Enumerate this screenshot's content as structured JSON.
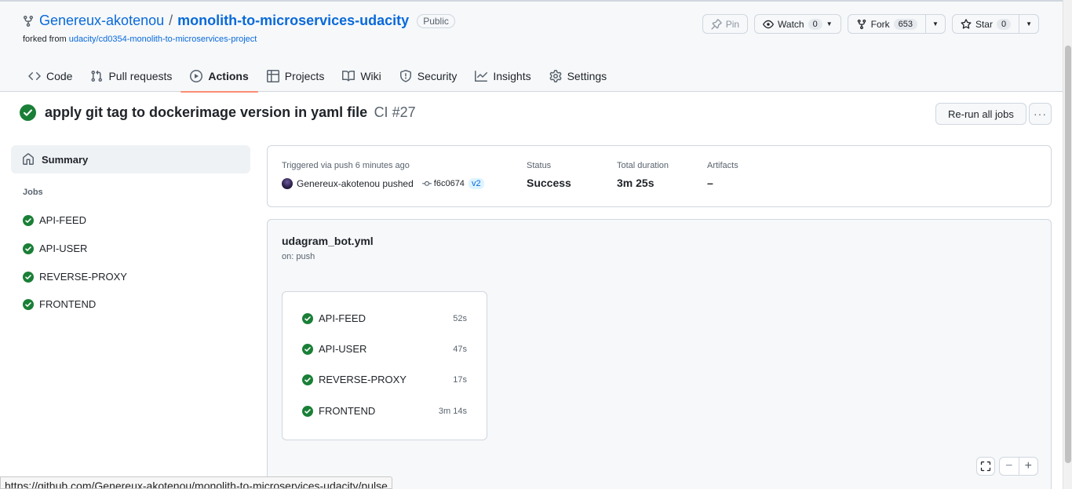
{
  "repo": {
    "owner": "Genereux-akotenou",
    "separator": "/",
    "name": "monolith-to-microservices-udacity",
    "visibility": "Public",
    "forked_prefix": "forked from",
    "forked_from": "udacity/cd0354-monolith-to-microservices-project"
  },
  "repo_actions": {
    "pin_label": "Pin",
    "watch_label": "Watch",
    "watch_count": "0",
    "fork_label": "Fork",
    "fork_count": "653",
    "star_label": "Star",
    "star_count": "0"
  },
  "nav": {
    "code": "Code",
    "pulls": "Pull requests",
    "actions": "Actions",
    "projects": "Projects",
    "wiki": "Wiki",
    "security": "Security",
    "insights": "Insights",
    "settings": "Settings"
  },
  "run": {
    "title": "apply git tag to dockerimage version in yaml file",
    "workflow_ref": "CI #27",
    "rerun_label": "Re-run all jobs",
    "more_label": "···"
  },
  "sidebar": {
    "summary_label": "Summary",
    "jobs_label": "Jobs",
    "jobs": [
      "API-FEED",
      "API-USER",
      "REVERSE-PROXY",
      "FRONTEND"
    ]
  },
  "summary": {
    "trigger_label": "Triggered via push 6 minutes ago",
    "actor_text": "Genereux-akotenou pushed",
    "commit_sha": "f6c0674",
    "tag": "v2",
    "status_label": "Status",
    "status_value": "Success",
    "duration_label": "Total duration",
    "duration_value": "3m 25s",
    "artifacts_label": "Artifacts",
    "artifacts_value": "–"
  },
  "workflow": {
    "file": "udagram_bot.yml",
    "on": "on: push",
    "jobs": [
      {
        "name": "API-FEED",
        "duration": "52s"
      },
      {
        "name": "API-USER",
        "duration": "47s"
      },
      {
        "name": "REVERSE-PROXY",
        "duration": "17s"
      },
      {
        "name": "FRONTEND",
        "duration": "3m 14s"
      }
    ],
    "zoom_out": "−",
    "zoom_in": "+"
  },
  "status_bar": {
    "url": "https://github.com/Genereux-akotenou/monolith-to-microservices-udacity/pulse"
  },
  "colors": {
    "success": "#1a7f37",
    "link": "#0969da",
    "active_tab": "#fd8c73"
  }
}
